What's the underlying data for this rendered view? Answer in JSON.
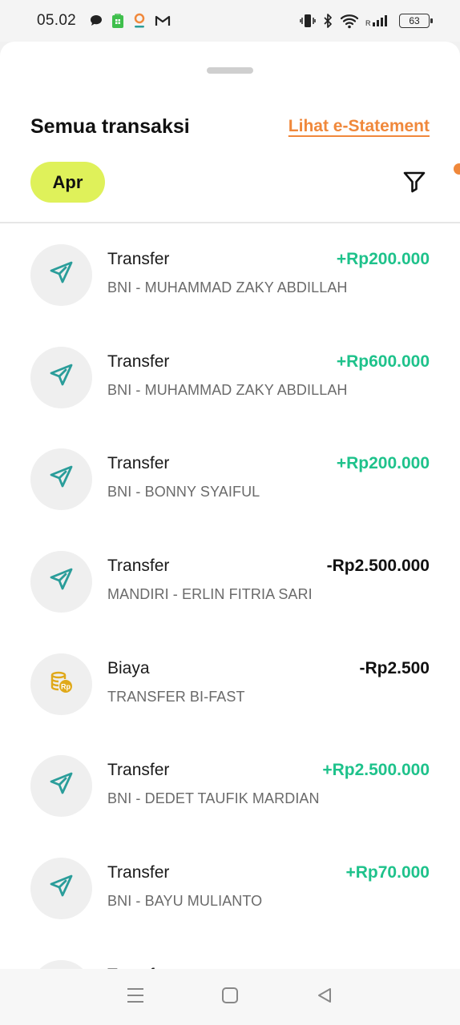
{
  "status_bar": {
    "time": "05.02",
    "battery": "63",
    "app_icons": [
      "chat-bubble-icon",
      "store-icon",
      "location-pin-icon",
      "gmail-icon"
    ],
    "system_icons": [
      "vibrate-icon",
      "bluetooth-icon",
      "wifi-icon",
      "signal-icon",
      "battery-icon"
    ]
  },
  "header": {
    "title": "Semua transaksi",
    "statement_link": "Lihat e-Statement",
    "month_filter": "Apr"
  },
  "colors": {
    "accent_orange": "#f0883b",
    "chip_yellow": "#dff15a",
    "positive_green": "#1ec28b",
    "transfer_icon_teal": "#2a9d9a",
    "fee_icon_gold": "#e0a91a"
  },
  "transactions": [
    {
      "type": "Transfer",
      "description": "BNI - MUHAMMAD ZAKY ABDILLAH",
      "amount": "+Rp200.000",
      "icon": "paper-plane-icon"
    },
    {
      "type": "Transfer",
      "description": "BNI - MUHAMMAD ZAKY ABDILLAH",
      "amount": "+Rp600.000",
      "icon": "paper-plane-icon"
    },
    {
      "type": "Transfer",
      "description": "BNI - BONNY SYAIFUL",
      "amount": "+Rp200.000",
      "icon": "paper-plane-icon"
    },
    {
      "type": "Transfer",
      "description": "MANDIRI - ERLIN FITRIA SARI",
      "amount": "-Rp2.500.000",
      "icon": "paper-plane-icon"
    },
    {
      "type": "Biaya",
      "description": "TRANSFER BI-FAST",
      "amount": "-Rp2.500",
      "icon": "coin-stack-icon"
    },
    {
      "type": "Transfer",
      "description": "BNI - DEDET TAUFIK MARDIAN",
      "amount": "+Rp2.500.000",
      "icon": "paper-plane-icon"
    },
    {
      "type": "Transfer",
      "description": "BNI - BAYU MULIANTO",
      "amount": "+Rp70.000",
      "icon": "paper-plane-icon"
    },
    {
      "type": "Transfer",
      "description": "",
      "amount": "",
      "icon": "paper-plane-icon"
    }
  ],
  "nav_bar": [
    "menu-icon",
    "home-square-icon",
    "back-triangle-icon"
  ]
}
